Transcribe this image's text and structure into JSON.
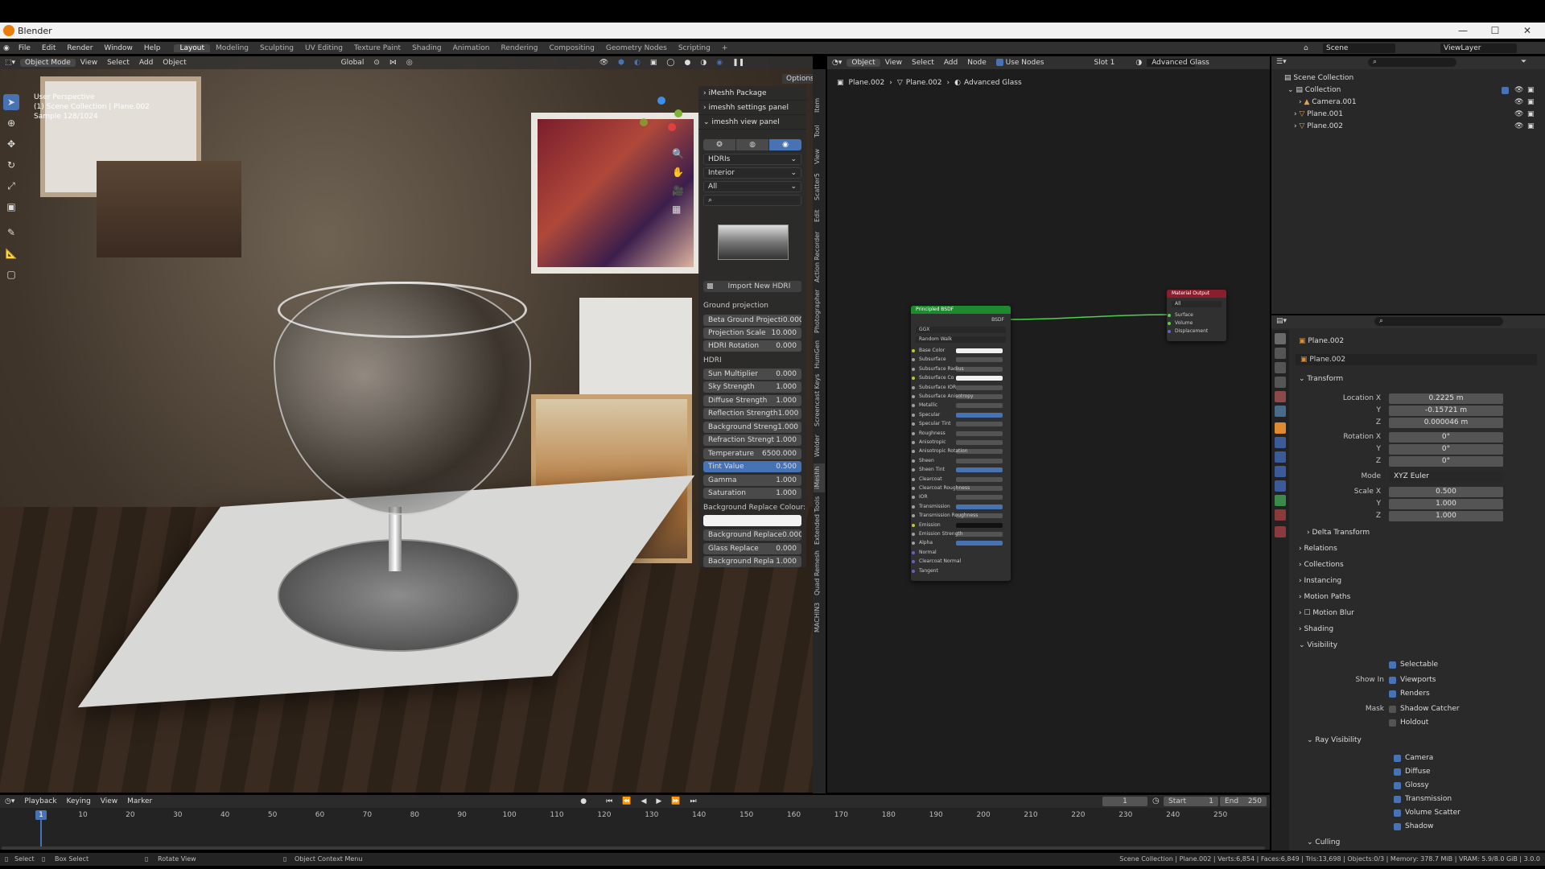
{
  "window": {
    "title": "Blender",
    "minimize": "—",
    "maximize": "☐",
    "close": "✕"
  },
  "menu": [
    "File",
    "Edit",
    "Render",
    "Window",
    "Help"
  ],
  "workspaces": [
    "Layout",
    "Modeling",
    "Sculpting",
    "UV Editing",
    "Texture Paint",
    "Shading",
    "Animation",
    "Rendering",
    "Compositing",
    "Geometry Nodes",
    "Scripting"
  ],
  "workspace_add": "+",
  "scene": {
    "label": "Scene",
    "viewlayer": "ViewLayer"
  },
  "viewport": {
    "mode": "Object Mode",
    "menus": [
      "View",
      "Select",
      "Add",
      "Object"
    ],
    "orientation": "Global",
    "options": "Options",
    "info": [
      "User Perspective",
      "(1) Scene Collection | Plane.002",
      "Sample 128/1024"
    ]
  },
  "npanel": {
    "sections": [
      "iMeshh Package",
      "imeshh settings panel",
      "imeshh view panel"
    ],
    "category": "HDRIs",
    "subcategory": "Interior",
    "filter": "All",
    "import_button": "Import New HDRI",
    "ground_label": "Ground projection",
    "ground_fields": [
      {
        "label": "Beta Ground Projecti",
        "value": "0.000"
      },
      {
        "label": "Projection Scale",
        "value": "10.000"
      },
      {
        "label": "HDRI Rotation",
        "value": "0.000"
      }
    ],
    "hdri_label": "HDRI",
    "hdri_fields": [
      {
        "label": "Sun Multiplier",
        "value": "0.000"
      },
      {
        "label": "Sky Strength",
        "value": "1.000"
      },
      {
        "label": "Diffuse Strength",
        "value": "1.000"
      },
      {
        "label": "Reflection Strength",
        "value": "1.000"
      },
      {
        "label": "Background Streng",
        "value": "1.000"
      },
      {
        "label": "Refraction Strengt",
        "value": "1.000"
      },
      {
        "label": "Temperature",
        "value": "6500.000"
      },
      {
        "label": "Tint Value",
        "value": "0.500"
      },
      {
        "label": "Gamma",
        "value": "1.000"
      },
      {
        "label": "Saturation",
        "value": "1.000"
      }
    ],
    "replace_label": "Background Replace Colour:",
    "replace_fields": [
      {
        "label": "Background Replace",
        "value": "0.000"
      },
      {
        "label": "Glass Replace",
        "value": "0.000"
      },
      {
        "label": "Background Repla",
        "value": "1.000"
      }
    ]
  },
  "side_tabs": [
    "Item",
    "Tool",
    "View",
    "Scatter5",
    "Edit",
    "Action Recorder",
    "Photographer",
    "HumGen",
    "Screencast Keys",
    "Welder",
    "iMeshh",
    "Extended Tools",
    "Quad Remesh",
    "MACHIN3"
  ],
  "node_editor": {
    "type": "Object",
    "menus": [
      "View",
      "Select",
      "Add",
      "Node"
    ],
    "use_nodes": "Use Nodes",
    "slot": "Slot 1",
    "material": "Advanced Glass",
    "breadcrumb": [
      "Plane.002",
      "Plane.002",
      "Advanced Glass"
    ],
    "bsdf": {
      "title": "Principled BSDF",
      "output": "BSDF",
      "dist": "GGX",
      "sss": "Random Walk",
      "rows": [
        "Base Color",
        "Subsurface",
        "Subsurface Radius",
        "Subsurface Co",
        "Subsurface IOR",
        "Subsurface Anisotropy",
        "Metallic",
        "Specular",
        "Specular Tint",
        "Roughness",
        "Anisotropic",
        "Anisotropic Rotation",
        "Sheen",
        "Sheen Tint",
        "Clearcoat",
        "Clearcoat Roughness",
        "IOR",
        "Transmission",
        "Transmission Roughness",
        "Emission",
        "Emission Strength",
        "Alpha",
        "Normal",
        "Clearcoat Normal",
        "Tangent"
      ]
    },
    "output": {
      "title": "Material Output",
      "target": "All",
      "rows": [
        "Surface",
        "Volume",
        "Displacement"
      ]
    }
  },
  "outliner": {
    "root": "Scene Collection",
    "collection": "Collection",
    "items": [
      "Camera.001",
      "Plane.001",
      "Plane.002"
    ]
  },
  "properties": {
    "object": "Plane.002",
    "datablock": "Plane.002",
    "transform": "Transform",
    "location": {
      "label": "Location X",
      "x": "0.2225 m",
      "y": "-0.15721 m",
      "z": "0.000046 m"
    },
    "rotation": {
      "label": "Rotation X",
      "x": "0°",
      "y": "0°",
      "z": "0°"
    },
    "mode_label": "Mode",
    "mode": "XYZ Euler",
    "scale": {
      "label": "Scale X",
      "x": "0.500",
      "y": "1.000",
      "z": "1.000"
    },
    "axis_y": "Y",
    "axis_z": "Z",
    "sections": [
      "Delta Transform",
      "Relations",
      "Collections",
      "Instancing",
      "Motion Paths",
      "Motion Blur",
      "Shading",
      "Visibility"
    ],
    "selectable": "Selectable",
    "show_in": "Show In",
    "viewports": "Viewports",
    "renders": "Renders",
    "mask": "Mask",
    "shadow_catcher": "Shadow Catcher",
    "holdout": "Holdout",
    "ray_visibility": "Ray Visibility",
    "rays": [
      "Camera",
      "Diffuse",
      "Glossy",
      "Transmission",
      "Volume Scatter",
      "Shadow"
    ],
    "culling": "Culling"
  },
  "timeline": {
    "menus": [
      "Playback",
      "Keying",
      "View",
      "Marker"
    ],
    "current": "1",
    "start_label": "Start",
    "start": "1",
    "end_label": "End",
    "end": "250",
    "ticks": [
      "10",
      "20",
      "30",
      "40",
      "50",
      "60",
      "70",
      "80",
      "90",
      "100",
      "110",
      "120",
      "130",
      "140",
      "150",
      "160",
      "170",
      "180",
      "190",
      "200",
      "210",
      "220",
      "230",
      "240",
      "250"
    ],
    "frame_marker": "1"
  },
  "status": {
    "select": "Select",
    "box_select": "Box Select",
    "rotate": "Rotate View",
    "context": "Object Context Menu",
    "stats": "Scene Collection | Plane.002 | Verts:6,854 | Faces:6,849 | Tris:13,698 | Objects:0/3 | Memory: 378.7 MiB | VRAM: 5.9/8.0 GiB | 3.0.0"
  },
  "colors": {
    "accent": "#4772b3",
    "header": "#303030",
    "bsdf_header": "#1e8a2e",
    "output_header": "#8a1e2e"
  }
}
